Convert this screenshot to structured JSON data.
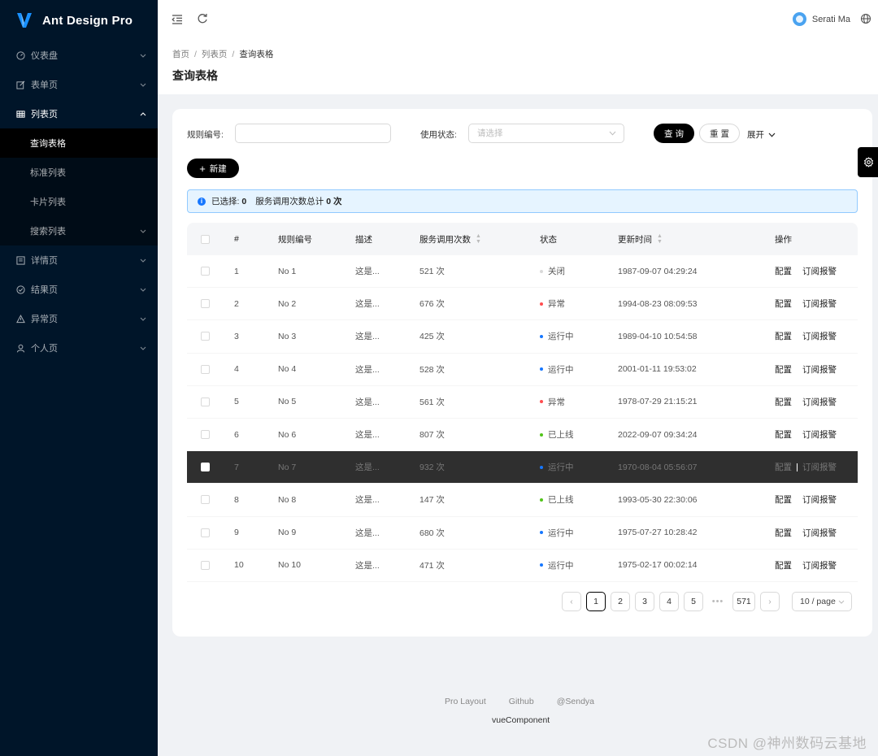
{
  "app": {
    "title": "Ant Design Pro"
  },
  "sidebar": {
    "items": [
      {
        "label": "仪表盘",
        "icon": "dashboard-icon"
      },
      {
        "label": "表单页",
        "icon": "form-icon"
      },
      {
        "label": "列表页",
        "icon": "table-icon",
        "open": true,
        "children": [
          {
            "label": "查询表格",
            "selected": true
          },
          {
            "label": "标准列表"
          },
          {
            "label": "卡片列表"
          },
          {
            "label": "搜索列表",
            "has_children": true
          }
        ]
      },
      {
        "label": "详情页",
        "icon": "profile-icon"
      },
      {
        "label": "结果页",
        "icon": "check-circle-icon"
      },
      {
        "label": "异常页",
        "icon": "warning-icon"
      },
      {
        "label": "个人页",
        "icon": "user-icon"
      }
    ]
  },
  "header": {
    "user_name": "Serati Ma"
  },
  "breadcrumb": [
    "首页",
    "列表页",
    "查询表格"
  ],
  "page_title": "查询表格",
  "search_form": {
    "rule_label": "规则编号:",
    "rule_value": "",
    "status_label": "使用状态:",
    "status_placeholder": "请选择",
    "query_label": "查 询",
    "reset_label": "重 置",
    "expand_label": "展开"
  },
  "toolbar": {
    "new_label": "新建"
  },
  "alert": {
    "selected_label": "已选择:",
    "selected_count": "0",
    "total_label": "服务调用次数总计",
    "total_value": "0 次"
  },
  "table": {
    "columns": [
      "#",
      "规则编号",
      "描述",
      "服务调用次数",
      "状态",
      "更新时间",
      "操作"
    ],
    "rows": [
      {
        "index": "1",
        "name": "No 1",
        "desc": "这是...",
        "calls": "521 次",
        "status": "关闭",
        "status_color": "#d9d9d9",
        "updated": "1987-09-07 04:29:24"
      },
      {
        "index": "2",
        "name": "No 2",
        "desc": "这是...",
        "calls": "676 次",
        "status": "异常",
        "status_color": "#ff4d4f",
        "updated": "1994-08-23 08:09:53"
      },
      {
        "index": "3",
        "name": "No 3",
        "desc": "这是...",
        "calls": "425 次",
        "status": "运行中",
        "status_color": "#1677ff",
        "updated": "1989-04-10 10:54:58"
      },
      {
        "index": "4",
        "name": "No 4",
        "desc": "这是...",
        "calls": "528 次",
        "status": "运行中",
        "status_color": "#1677ff",
        "updated": "2001-01-11 19:53:02"
      },
      {
        "index": "5",
        "name": "No 5",
        "desc": "这是...",
        "calls": "561 次",
        "status": "异常",
        "status_color": "#ff4d4f",
        "updated": "1978-07-29 21:15:21"
      },
      {
        "index": "6",
        "name": "No 6",
        "desc": "这是...",
        "calls": "807 次",
        "status": "已上线",
        "status_color": "#52c41a",
        "updated": "2022-09-07 09:34:24"
      },
      {
        "index": "7",
        "name": "No 7",
        "desc": "这是...",
        "calls": "932 次",
        "status": "运行中",
        "status_color": "#1677ff",
        "updated": "1970-08-04 05:56:07",
        "highlighted": true
      },
      {
        "index": "8",
        "name": "No 8",
        "desc": "这是...",
        "calls": "147 次",
        "status": "已上线",
        "status_color": "#52c41a",
        "updated": "1993-05-30 22:30:06"
      },
      {
        "index": "9",
        "name": "No 9",
        "desc": "这是...",
        "calls": "680 次",
        "status": "运行中",
        "status_color": "#1677ff",
        "updated": "1975-07-27 10:28:42"
      },
      {
        "index": "10",
        "name": "No 10",
        "desc": "这是...",
        "calls": "471 次",
        "status": "运行中",
        "status_color": "#1677ff",
        "updated": "1975-02-17 00:02:14"
      }
    ],
    "actions": [
      "配置",
      "订阅报警"
    ]
  },
  "pagination": {
    "pages": [
      "1",
      "2",
      "3",
      "4",
      "5"
    ],
    "current": "1",
    "ellipsis": "•••",
    "last": "571",
    "page_size": "10 / page"
  },
  "footer": {
    "links": [
      "Pro Layout",
      "Github",
      "@Sendya"
    ],
    "copyright": "vueComponent"
  },
  "watermark": "CSDN @神州数码云基地"
}
